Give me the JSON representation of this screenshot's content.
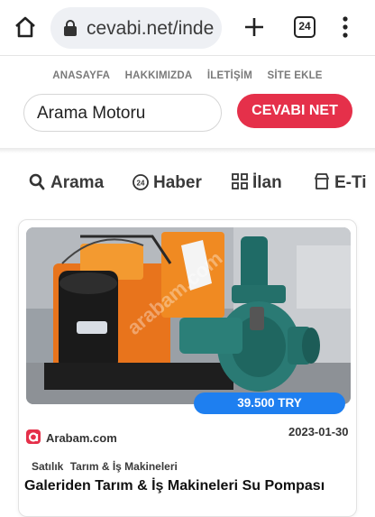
{
  "browser": {
    "url": "cevabi.net/inde",
    "tab_count": "24"
  },
  "topnav": [
    "ANASAYFA",
    "HAKKIMIZDA",
    "İLETİŞİM",
    "SİTE EKLE"
  ],
  "search": {
    "value": "Arama Motoru",
    "button_label": "CEVABI NET"
  },
  "categories": [
    {
      "label": "Arama",
      "icon": "search-icon"
    },
    {
      "label": "Haber",
      "icon": "news-24-icon"
    },
    {
      "label": "İlan",
      "icon": "grid-icon"
    },
    {
      "label": "E-Ti",
      "icon": "store-icon"
    }
  ],
  "listing": {
    "price": "39.500  TRY",
    "source": "Arabam.com",
    "date": "2023-01-30",
    "tags": [
      "Satılık",
      "Tarım & İş Makineleri"
    ],
    "title": "Galeriden Tarım & İş Makineleri Su Pompası",
    "watermark": "arabam.com"
  },
  "colors": {
    "accent_red": "#e5304a",
    "price_blue": "#1e7ff0"
  }
}
